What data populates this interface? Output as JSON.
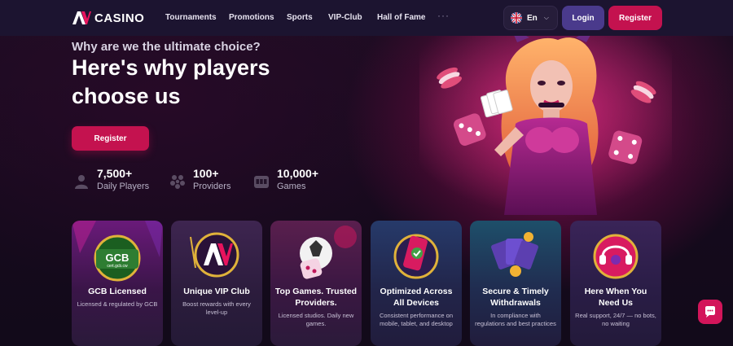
{
  "brand": {
    "name": "CASINO"
  },
  "nav": {
    "links": [
      "Tournaments",
      "Promotions",
      "Sports",
      "VIP-Club",
      "Hall of Fame"
    ],
    "more": "···",
    "language": "En",
    "login_label": "Login",
    "register_label": "Register"
  },
  "hero": {
    "eyebrow": "Why are we the ultimate choice?",
    "headline": "Here's why players choose us",
    "register_label": "Register",
    "stats": [
      {
        "value": "7,500+",
        "label": "Daily Players",
        "icon": "players-icon"
      },
      {
        "value": "100+",
        "label": "Providers",
        "icon": "providers-icon"
      },
      {
        "value": "10,000+",
        "label": "Games",
        "icon": "slot-machine-icon"
      }
    ]
  },
  "cards": [
    {
      "title": "GCB Licensed",
      "desc": "Licensed & regulated by GCB",
      "badge_text": "GCB",
      "badge_sub": "cert.gcb.cw",
      "icon": "gcb-license-icon"
    },
    {
      "title": "Unique VIP Club",
      "desc": "Boost rewards with every level-up",
      "icon": "vip-club-icon"
    },
    {
      "title": "Top Games. Trusted Providers.",
      "desc": "Licensed studios. Daily new games.",
      "icon": "games-icon"
    },
    {
      "title": "Optimized Across All Devices",
      "desc": "Consistent performance on mobile, tablet, and desktop",
      "icon": "devices-icon"
    },
    {
      "title": "Secure & Timely Withdrawals",
      "desc": "In compliance with regulations and best practices",
      "icon": "withdrawals-icon"
    },
    {
      "title": "Here When You Need Us",
      "desc": "Real support, 24/7 — no bots, no waiting",
      "icon": "support-icon"
    }
  ],
  "colors": {
    "accent": "#c4124f",
    "login": "#4a3a8c",
    "nav_bg": "#1c1430"
  }
}
